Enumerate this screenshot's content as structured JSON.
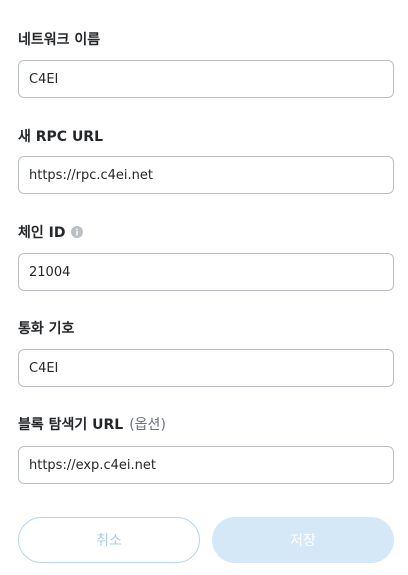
{
  "form": {
    "network_name": {
      "label": "네트워크 이름",
      "value": "C4EI"
    },
    "rpc_url": {
      "label": "새 RPC URL",
      "value": "https://rpc.c4ei.net"
    },
    "chain_id": {
      "label": "체인 ID",
      "info_icon": "info-circle-icon",
      "value": "21004"
    },
    "currency_symbol": {
      "label": "통화 기호",
      "value": "C4EI"
    },
    "block_explorer": {
      "label": "블록 탐색기 URL",
      "optional": "(옵션)",
      "value": "https://exp.c4ei.net"
    }
  },
  "actions": {
    "cancel_label": "취소",
    "save_label": "저장"
  },
  "colors": {
    "text": "#24272a",
    "border": "#bbc0c5",
    "accent_light": "#d5e8f8",
    "cancel_border": "#b8d7f3"
  }
}
